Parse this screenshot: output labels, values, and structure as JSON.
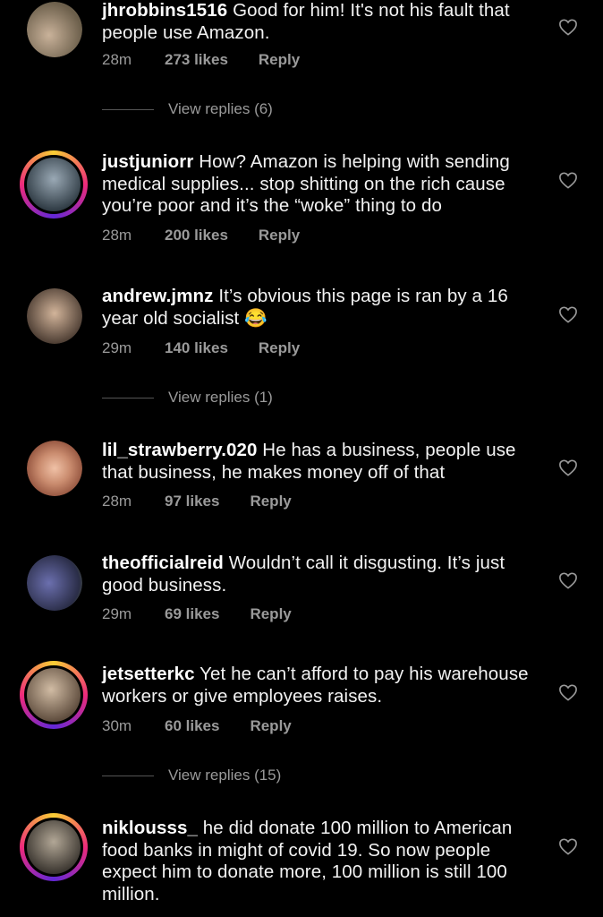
{
  "comments": [
    {
      "username": "jhrobbins1516",
      "text": "Good for him! It's not his fault that people use Amazon.",
      "time": "28m",
      "likes": "273 likes",
      "reply": "Reply",
      "colors": [
        "#b7a590",
        "#6c5f4b"
      ]
    },
    {
      "username": "justjuniorr",
      "text": "How? Amazon is helping with sending medical supplies... stop shitting on the rich cause you’re poor and it’s the “woke” thing to do",
      "time": "28m",
      "likes": "200 likes",
      "reply": "Reply",
      "colors": [
        "#8a9aa7",
        "#2f3b44"
      ]
    },
    {
      "username": "andrew.jmnz",
      "text": "It’s obvious this page is ran by a 16 year old socialist 😂",
      "time": "29m",
      "likes": "140 likes",
      "reply": "Reply",
      "colors": [
        "#c4a68e",
        "#4a3b31"
      ]
    },
    {
      "username": "lil_strawberry.020",
      "text": "He has a business, people use that business, he makes money off of that",
      "time": "28m",
      "likes": "97 likes",
      "reply": "Reply",
      "colors": [
        "#e7b197",
        "#8a4a36"
      ]
    },
    {
      "username": "theofficialreid",
      "text": "Wouldn’t call it disgusting. It’s just good business.",
      "time": "29m",
      "likes": "69 likes",
      "reply": "Reply",
      "colors": [
        "#6b6fae",
        "#2a2d47"
      ]
    },
    {
      "username": "jetsetterkc",
      "text": "Yet he can’t afford to pay his warehouse workers or give employees raises.",
      "time": "30m",
      "likes": "60 likes",
      "reply": "Reply",
      "colors": [
        "#b9a48d",
        "#5c4a3b"
      ]
    },
    {
      "username": "niklousss_",
      "text": "he did donate 100 million to American food banks in might of covid 19. So now people expect him to donate more, 100 million is still 100 million.",
      "time": "",
      "likes": "",
      "reply": "",
      "colors": [
        "#8e8578",
        "#3a352f"
      ]
    }
  ],
  "view_replies": [
    "View replies (6)",
    "View replies (1)",
    "View replies (15)"
  ]
}
